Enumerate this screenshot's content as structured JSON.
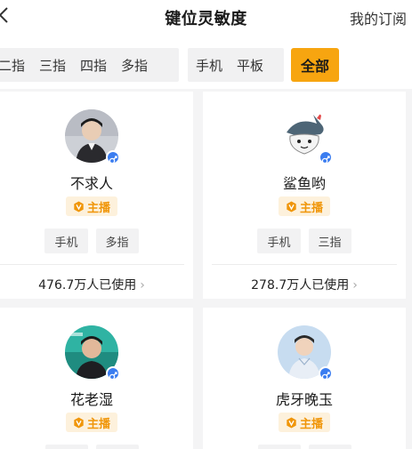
{
  "header": {
    "title": "键位灵敏度",
    "subscribe_label": "我的订阅"
  },
  "filters": {
    "finger_chips": [
      "二指",
      "三指",
      "四指",
      "多指"
    ],
    "device_chips": [
      "手机",
      "平板"
    ],
    "all_label": "全部",
    "all_color": "#f7a510"
  },
  "streamer_badge_label": "主播",
  "cards": [
    {
      "name": "不求人",
      "tags": [
        "手机",
        "多指"
      ],
      "usage": "476.7万人已使用",
      "gender": "male"
    },
    {
      "name": "鲨鱼哟",
      "tags": [
        "手机",
        "三指"
      ],
      "usage": "278.7万人已使用",
      "gender": "male"
    },
    {
      "name": "花老湿",
      "tags": [],
      "usage": "",
      "gender": "male"
    },
    {
      "name": "虎牙晚玉",
      "tags": [],
      "usage": "",
      "gender": "male"
    }
  ]
}
